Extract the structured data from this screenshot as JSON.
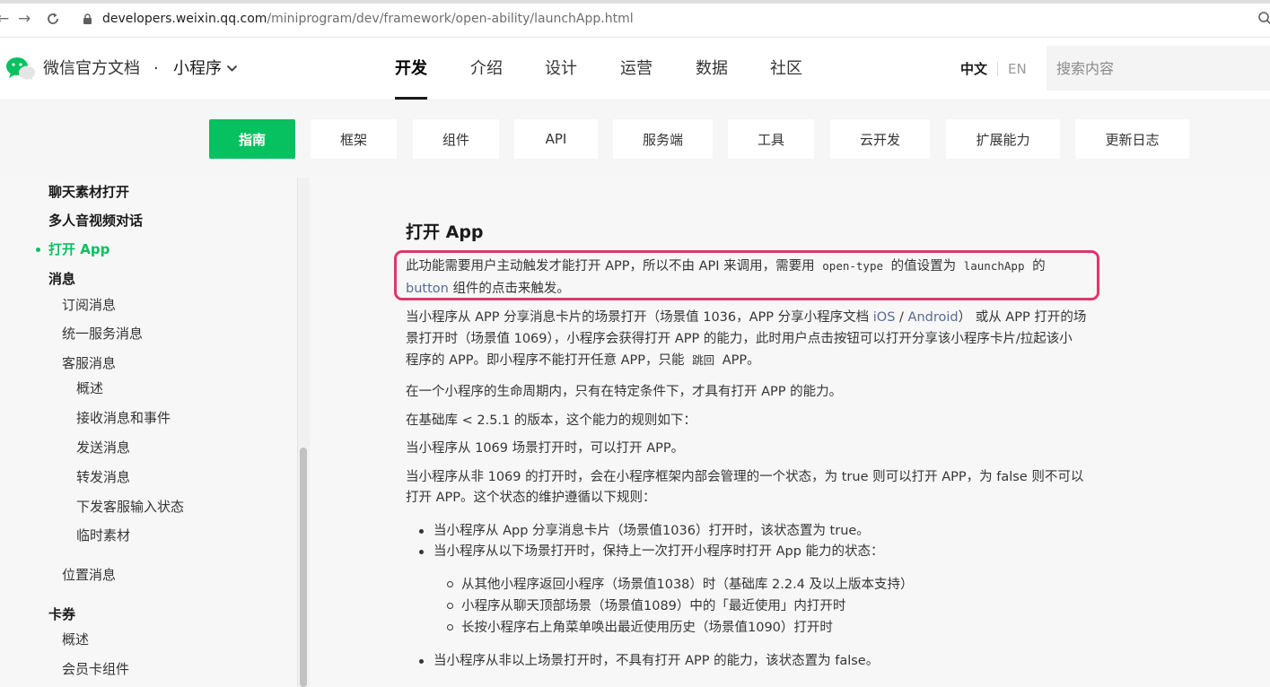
{
  "browser": {
    "url_host": "developers.weixin.qq.com",
    "url_path": "/miniprogram/dev/framework/open-ability/launchApp.html"
  },
  "header": {
    "brand": "微信官方文档",
    "dot": "·",
    "product": "小程序",
    "nav": [
      "开发",
      "介绍",
      "设计",
      "运营",
      "数据",
      "社区"
    ],
    "lang_zh": "中文",
    "lang_en": "EN",
    "search_placeholder": "搜索内容"
  },
  "subnav": [
    "指南",
    "框架",
    "组件",
    "API",
    "服务端",
    "工具",
    "云开发",
    "扩展能力",
    "更新日志"
  ],
  "sidebar": {
    "items": [
      "聊天素材打开",
      "多人音视频对话",
      "打开 App",
      "消息",
      "订阅消息",
      "统一服务消息",
      "客服消息",
      "概述",
      "接收消息和事件",
      "发送消息",
      "转发消息",
      "下发客服输入状态",
      "临时素材",
      "位置消息",
      "卡券",
      "概述",
      "会员卡组件"
    ]
  },
  "article": {
    "title": "打开 App",
    "hl_line1_a": "此功能需要用户主动触发才能打开 APP，所以不由 API 来调用，需要用",
    "hl_code1": "open-type",
    "hl_line1_b": "的值设置为",
    "hl_code2": "launchApp",
    "hl_line1_c": "的",
    "hl_link": "button",
    "hl_line2": "组件的点击来触发。",
    "p2_line1_a": "当小程序从 APP 分享消息卡片的场景打开（场景值 1036，APP 分享小程序文档",
    "p2_link_ios": "iOS",
    "p2_slash": "/",
    "p2_link_android": "Android",
    "p2_line1_b": "） 或从 APP 打开的场",
    "p2_line2": "景打开时（场景值 1069），小程序会获得打开 APP 的能力，此时用户点击按钮可以打开分享该小程序卡片/拉起该小",
    "p2_line3_a": "程序的 APP。即小程序不能打开任意 APP，只能",
    "p2_code": "跳回",
    "p2_line3_b": "APP。",
    "p3": "在一个小程序的生命周期内，只有在特定条件下，才具有打开 APP 的能力。",
    "p4": "在基础库 < 2.5.1 的版本，这个能力的规则如下：",
    "p5": "当小程序从 1069 场景打开时，可以打开 APP。",
    "p6_line1": "当小程序从非 1069 的打开时，会在小程序框架内部会管理的一个状态，为 true 则可以打开 APP，为 false 则不可以",
    "p6_line2": "打开 APP。这个状态的维护遵循以下规则：",
    "li1": "当小程序从 App 分享消息卡片（场景值1036）打开时，该状态置为 true。",
    "li2": "当小程序从以下场景打开时，保持上一次打开小程序时打开 App 能力的状态：",
    "li2_sub": [
      "从其他小程序返回小程序（场景值1038）时（基础库 2.2.4 及以上版本支持）",
      "小程序从聊天顶部场景（场景值1089）中的「最近使用」内打开时",
      "长按小程序右上角菜单唤出最近使用历史（场景值1090）打开时"
    ],
    "li3": "当小程序从非以上场景打开时，不具有打开 APP 的能力，该状态置为 false。"
  }
}
